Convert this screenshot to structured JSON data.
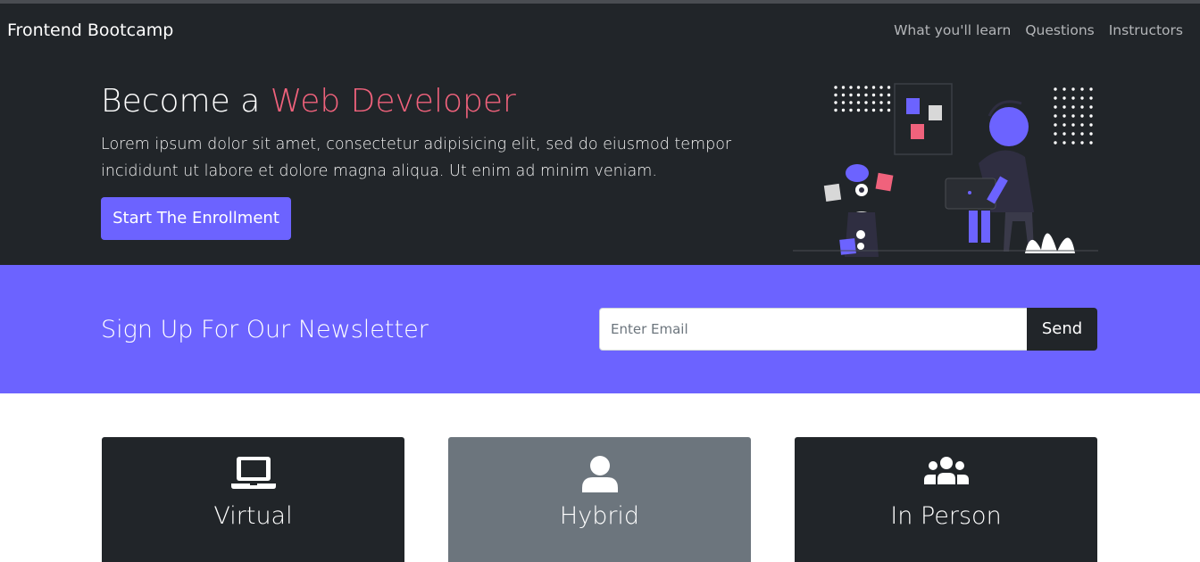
{
  "navbar": {
    "brand": "Frontend Bootcamp",
    "links": [
      {
        "label": "What you'll learn"
      },
      {
        "label": "Questions"
      },
      {
        "label": "Instructors"
      }
    ]
  },
  "hero": {
    "title_prefix": "Become a ",
    "title_accent": "Web Developer",
    "text": "Lorem ipsum dolor sit amet, consectetur adipisicing elit, sed do eiusmod tempor incididunt ut labore et dolore magna aliqua. Ut enim ad minim veniam.",
    "button_label": "Start The Enrollment",
    "accent_color": "#f0627c",
    "brand_color": "#6c63ff"
  },
  "newsletter": {
    "title": "Sign Up For Our Newsletter",
    "email_placeholder": "Enter Email",
    "email_value": "",
    "send_label": "Send"
  },
  "cards": [
    {
      "title": "Virtual",
      "icon": "laptop-icon"
    },
    {
      "title": "Hybrid",
      "icon": "person-icon"
    },
    {
      "title": "In Person",
      "icon": "people-icon"
    }
  ]
}
